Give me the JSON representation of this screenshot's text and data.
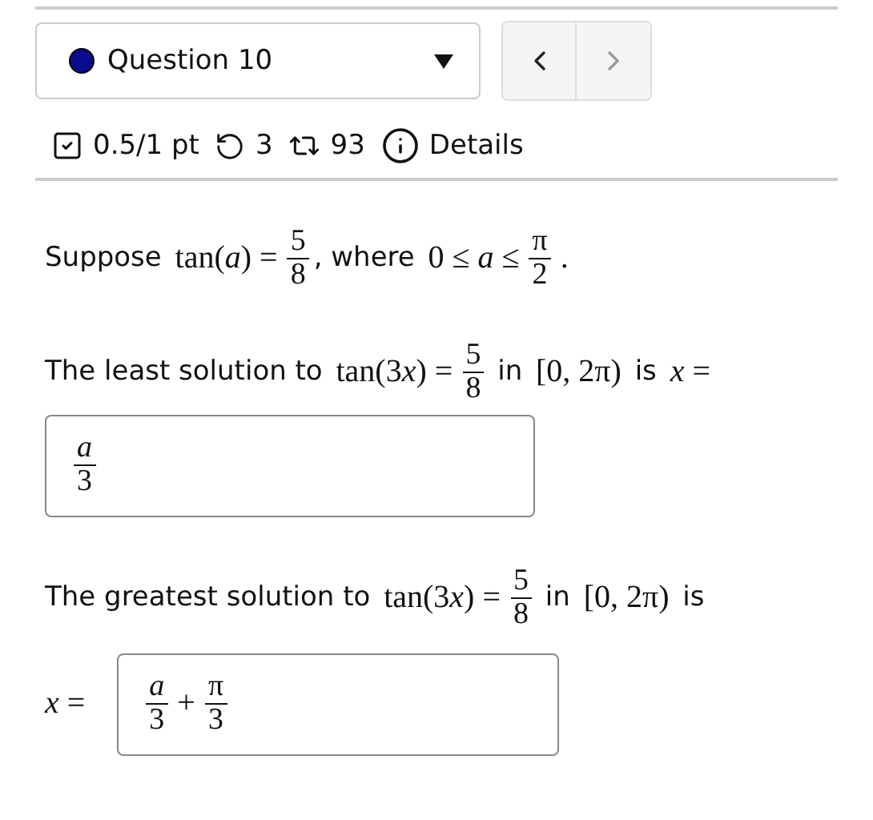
{
  "question_select": {
    "label": "Question 10",
    "color": "#0a0a8c"
  },
  "nav": [
    {
      "kind": "previous",
      "disabled": false
    },
    {
      "kind": "next",
      "disabled": true
    }
  ],
  "meta": [
    {
      "kind": "score",
      "text": "0.5/1 pt"
    },
    {
      "kind": "retries",
      "text": "3"
    },
    {
      "kind": "attempts",
      "text": "93"
    },
    {
      "kind": "details",
      "text": "Details"
    }
  ],
  "parts": [
    {
      "kind": "sentence",
      "segments": [
        {
          "kind": "text",
          "text": "Suppose "
        },
        {
          "kind": "math",
          "text": "tan(*a*) ="
        },
        {
          "kind": "frac",
          "num": "5",
          "den": "8"
        },
        {
          "kind": "text",
          "text": ", where "
        },
        {
          "kind": "math",
          "text": "0 ≤ *a* ≤"
        },
        {
          "kind": "frac",
          "num": "π",
          "den": "2"
        },
        {
          "kind": "math",
          "text": "."
        }
      ]
    },
    {
      "kind": "sentence",
      "segments": [
        {
          "kind": "text",
          "text": "The least solution to "
        },
        {
          "kind": "math",
          "text": "tan(3"
        },
        {
          "kind": "var",
          "text": "x"
        },
        {
          "kind": "math",
          "text": ") ="
        },
        {
          "kind": "frac",
          "num": "5",
          "den": "8"
        },
        {
          "kind": "text",
          "text": " in "
        },
        {
          "kind": "math",
          "text": "[0, 2π)"
        },
        {
          "kind": "text",
          "text": " is "
        },
        {
          "kind": "math",
          "text": "*x* ="
        }
      ]
    },
    {
      "kind": "answer",
      "segments": [
        {
          "kind": "frac",
          "num": "*a*",
          "den": "3"
        }
      ]
    },
    {
      "kind": "sentence",
      "segments": [
        {
          "kind": "text",
          "text": "The greatest solution to "
        },
        {
          "kind": "math",
          "text": "tan(3"
        },
        {
          "kind": "var",
          "text": "x"
        },
        {
          "kind": "math",
          "text": ") ="
        },
        {
          "kind": "frac",
          "num": "5",
          "den": "8"
        },
        {
          "kind": "text",
          "text": " in "
        },
        {
          "kind": "math",
          "text": "[0, 2π)"
        },
        {
          "kind": "text",
          "text": " is"
        }
      ]
    },
    {
      "kind": "answer",
      "label": "*x* =",
      "segments": [
        {
          "kind": "frac",
          "num": "*a*",
          "den": "3"
        },
        {
          "kind": "math",
          "text": "+"
        },
        {
          "kind": "frac",
          "num": "π",
          "den": "3"
        }
      ]
    }
  ]
}
